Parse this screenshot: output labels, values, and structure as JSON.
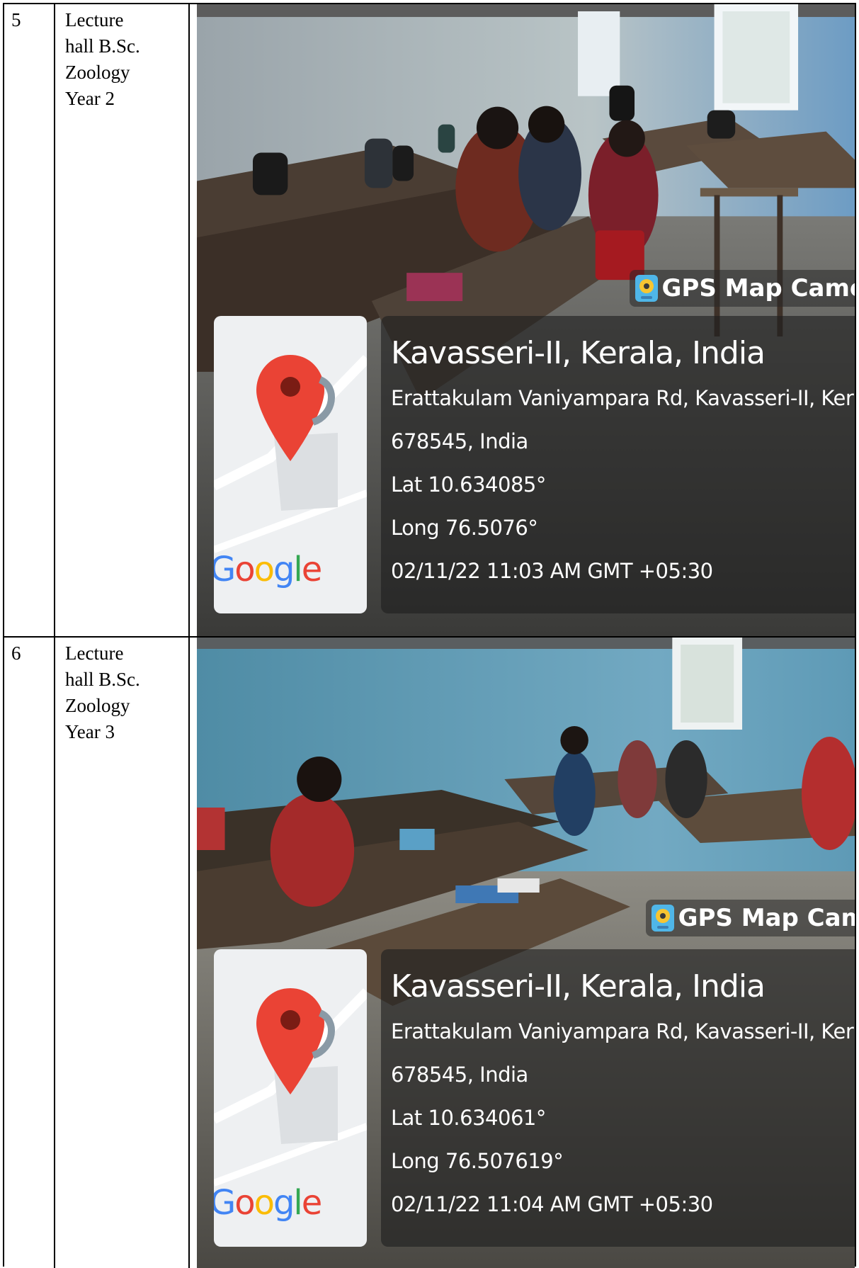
{
  "rows": [
    {
      "number": "5",
      "description": [
        "Lecture",
        "hall B.Sc.",
        "Zoology",
        "Year 2"
      ],
      "photo": {
        "gps_badge": "GPS Map Came",
        "location_title": "Kavasseri-II, Kerala, India",
        "address_line1": "Erattakulam Vaniyampara Rd, Kavasseri-II, Kerala",
        "address_line2": "678545, India",
        "lat": "Lat 10.634085°",
        "long": "Long 76.5076°",
        "timestamp": "02/11/22 11:03 AM GMT +05:30",
        "map_brand": "Google"
      }
    },
    {
      "number": "6",
      "description": [
        "Lecture",
        "hall B.Sc.",
        "Zoology",
        "Year 3"
      ],
      "photo": {
        "gps_badge": "GPS Map Cam",
        "location_title": "Kavasseri-II, Kerala, India",
        "address_line1": "Erattakulam Vaniyampara Rd, Kavasseri-II, Kerala",
        "address_line2": "678545, India",
        "lat": "Lat 10.634061°",
        "long": "Long 76.507619°",
        "timestamp": "02/11/22 11:04 AM GMT +05:30",
        "map_brand": "Google"
      }
    }
  ],
  "colors": {
    "map_pin": "#EA4335",
    "map_bg": "#eef0f2",
    "overlay": "#1e1e1e"
  }
}
